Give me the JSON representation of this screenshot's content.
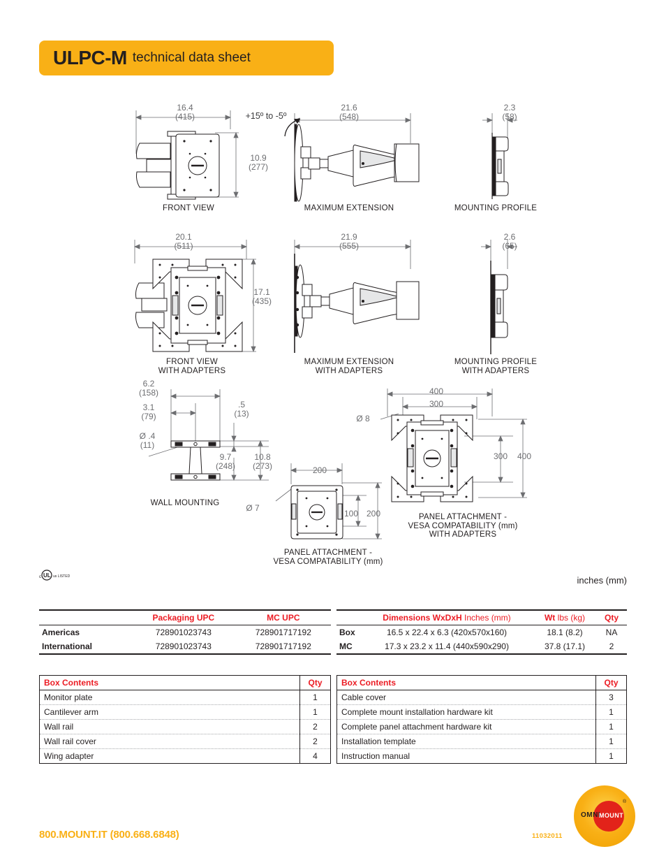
{
  "header": {
    "model": "ULPC-M",
    "subtitle": "technical data sheet",
    "accent_color": "#f9b016"
  },
  "drawings": {
    "unit_note": "inches (mm)",
    "views": [
      {
        "id": "front-view",
        "label": "FRONT VIEW",
        "width_in": "16.4",
        "width_mm": "(415)",
        "height_in": "10.9",
        "height_mm": "(277)"
      },
      {
        "id": "maximum-extension",
        "label": "MAXIMUM EXTENSION",
        "tilt": "+15º to -5º",
        "width_in": "21.6",
        "width_mm": "(548)"
      },
      {
        "id": "mounting-profile",
        "label": "MOUNTING PROFILE",
        "depth_in": "2.3",
        "depth_mm": "(58)"
      },
      {
        "id": "front-view-adapters",
        "label": "FRONT VIEW\nWITH ADAPTERS",
        "width_in": "20.1",
        "width_mm": "(511)",
        "height_in": "17.1",
        "height_mm": "(435)"
      },
      {
        "id": "maximum-extension-adapters",
        "label": "MAXIMUM EXTENSION\nWITH ADAPTERS",
        "width_in": "21.9",
        "width_mm": "(555)"
      },
      {
        "id": "mounting-profile-adapters",
        "label": "MOUNTING PROFILE\nWITH ADAPTERS",
        "depth_in": "2.6",
        "depth_mm": "(65)"
      },
      {
        "id": "wall-mounting",
        "label": "WALL MOUNTING",
        "d1_in": "6.2",
        "d1_mm": "(158)",
        "d2_in": "3.1",
        "d2_mm": "(79)",
        "hole_in": "Ø .4",
        "hole_mm": "(11)",
        "d3_in": ".5",
        "d3_mm": "(13)",
        "d4_in": "9.7",
        "d4_mm": "(248)",
        "d5_in": "10.8",
        "d5_mm": "(273)"
      },
      {
        "id": "panel-attachment-vesa",
        "label": "PANEL ATTACHMENT -\nVESA COMPATABILITY (mm)",
        "width": "200",
        "height_a": "100",
        "height_b": "200",
        "hole": "Ø 7"
      },
      {
        "id": "panel-attachment-vesa-adapters",
        "label": "PANEL ATTACHMENT -\nVESA COMPATABILITY (mm)\nWITH ADAPTERS",
        "width_a": "400",
        "width_b": "300",
        "height_a": "300",
        "height_b": "400",
        "hole": "Ø 8"
      }
    ]
  },
  "upc_table": {
    "headers": [
      "",
      "Packaging UPC",
      "MC UPC"
    ],
    "rows": [
      {
        "region": "Americas",
        "packaging_upc": "728901023743",
        "mc_upc": "728901717192"
      },
      {
        "region": "International",
        "packaging_upc": "728901023743",
        "mc_upc": "728901717192"
      }
    ]
  },
  "dimensions_table": {
    "header_dimensions_bold": "Dimensions WxDxH",
    "header_dimensions_light": "Inches (mm)",
    "header_wt_bold": "Wt",
    "header_wt_light": "lbs (kg)",
    "header_qty": "Qty",
    "rows": [
      {
        "name": "Box",
        "dimensions": "16.5 x 22.4 x 6.3 (420x570x160)",
        "weight": "18.1 (8.2)",
        "qty": "NA"
      },
      {
        "name": "MC",
        "dimensions": "17.3 x 23.2 x 11.4 (440x590x290)",
        "weight": "37.8 (17.1)",
        "qty": "2"
      }
    ]
  },
  "contents_left": {
    "header_name": "Box Contents",
    "header_qty": "Qty",
    "rows": [
      {
        "item": "Monitor plate",
        "qty": "1"
      },
      {
        "item": "Cantilever arm",
        "qty": "1"
      },
      {
        "item": "Wall rail",
        "qty": "2"
      },
      {
        "item": "Wall rail cover",
        "qty": "2"
      },
      {
        "item": "Wing adapter",
        "qty": "4"
      }
    ]
  },
  "contents_right": {
    "header_name": "Box Contents",
    "header_qty": "Qty",
    "rows": [
      {
        "item": "Cable cover",
        "qty": "3"
      },
      {
        "item": "Complete mount installation hardware kit",
        "qty": "1"
      },
      {
        "item": "Complete panel attachment hardware kit",
        "qty": "1"
      },
      {
        "item": "Installation template",
        "qty": "1"
      },
      {
        "item": "Instruction manual",
        "qty": "1"
      }
    ]
  },
  "footer": {
    "phone": "800.MOUNT.IT (800.668.6848)",
    "doc_number": "11032011",
    "logo_omni": "OMNI",
    "logo_mount": "MOUNT",
    "logo_tm": "®"
  }
}
